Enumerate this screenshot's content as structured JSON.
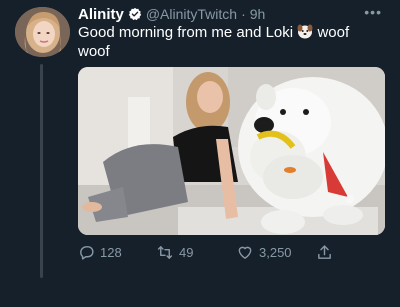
{
  "tweet": {
    "display_name": "Alinity",
    "handle": "@AlinityTwitch",
    "separator": "·",
    "time": "9h",
    "text_before_emoji": "Good morning from me and Loki ",
    "text_after_emoji": " woof woof",
    "emoji": "dog-face"
  },
  "actions": {
    "replies": "128",
    "retweets": "49",
    "likes": "3,250"
  },
  "colors": {
    "background": "#15202b",
    "secondary_text": "#8899a6",
    "verified": "#1da1f2"
  }
}
